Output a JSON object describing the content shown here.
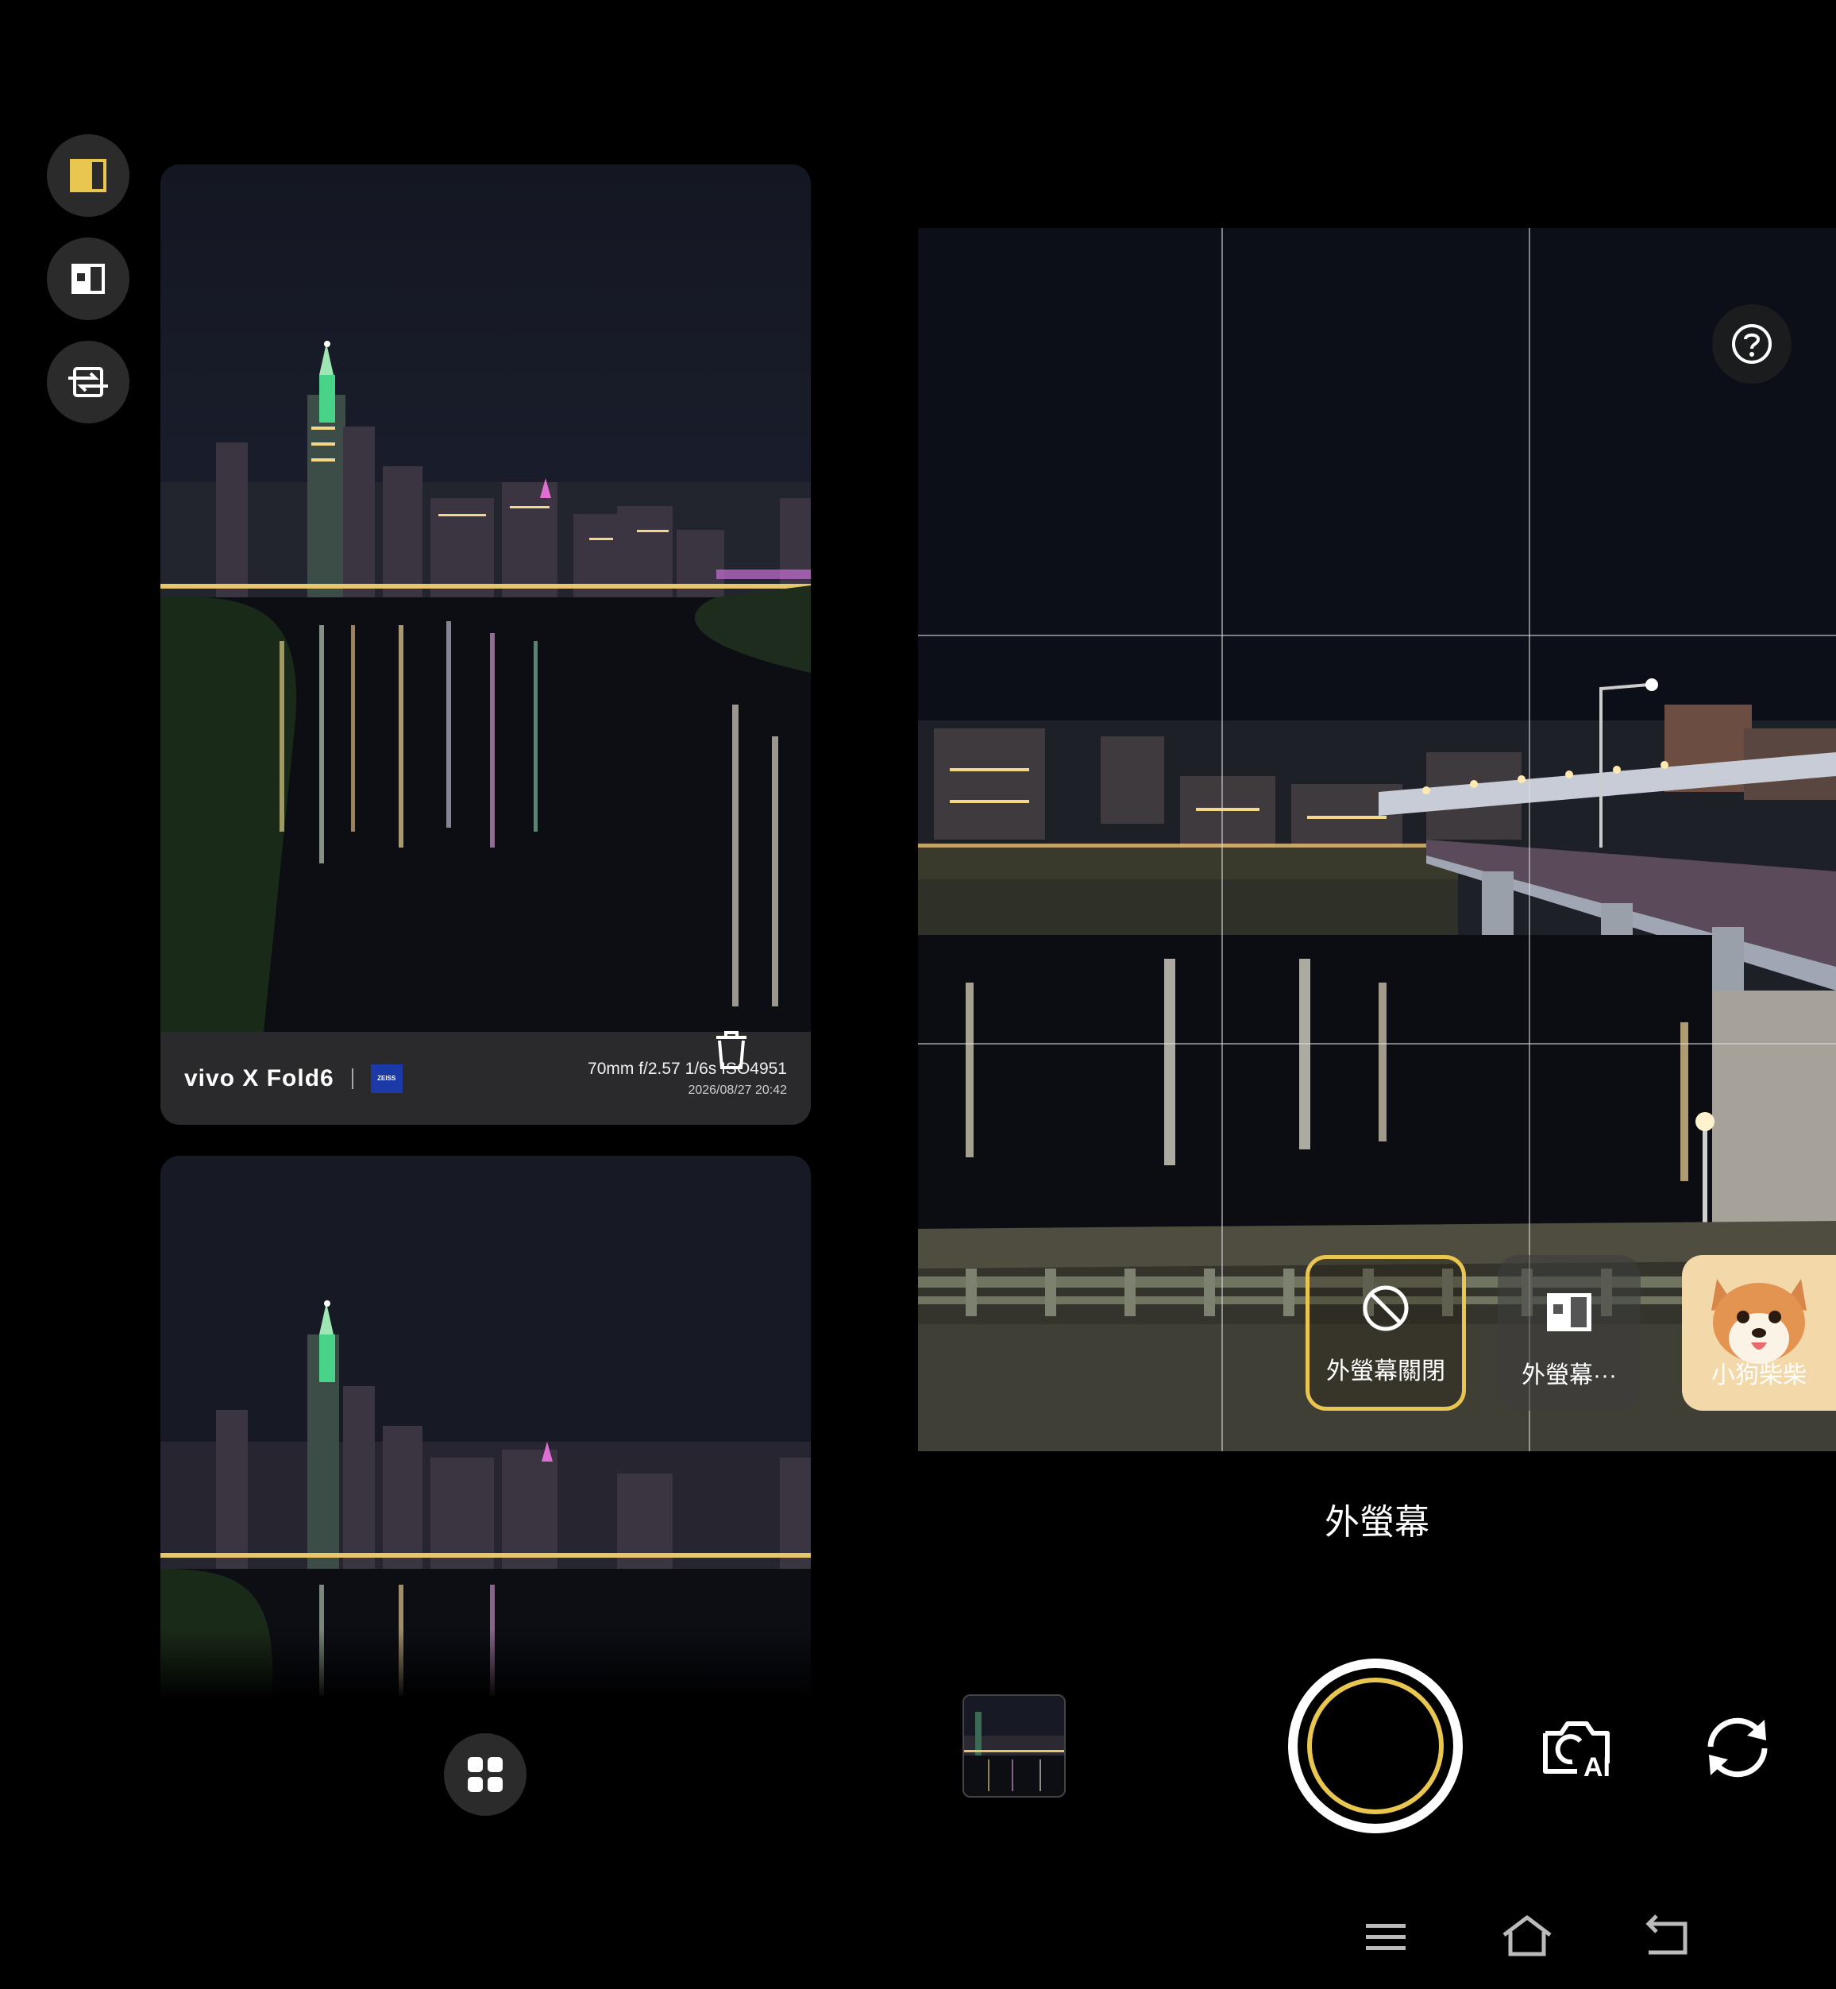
{
  "sidebar": {
    "buttons": [
      {
        "name": "rear-screen-mode",
        "icon": "rear-screen-icon",
        "active": true
      },
      {
        "name": "dual-preview-mode",
        "icon": "dual-preview-icon",
        "active": false
      },
      {
        "name": "switch-screen-mode",
        "icon": "switch-screen-icon",
        "active": false
      }
    ]
  },
  "photo_top": {
    "watermark": {
      "brand": "vivo X Fold6",
      "zeiss_logo_text": "ZEISS",
      "specs": "70mm  f/2.57  1/6s  ISO4951",
      "datetime": "2026/08/27 20:42"
    }
  },
  "viewfinder": {
    "effects": [
      {
        "label": "外螢幕關閉",
        "icon": "no-sign-icon",
        "selected": true
      },
      {
        "label": "外螢幕···",
        "icon": "rear-screen-icon",
        "selected": false
      },
      {
        "label": "小狗柴柴",
        "icon": "shiba-dog-icon",
        "selected": false
      }
    ]
  },
  "mode_label": "外螢幕",
  "colors": {
    "accent": "#e9c650",
    "button_bg": "#2b2b2b",
    "background": "#000000"
  }
}
